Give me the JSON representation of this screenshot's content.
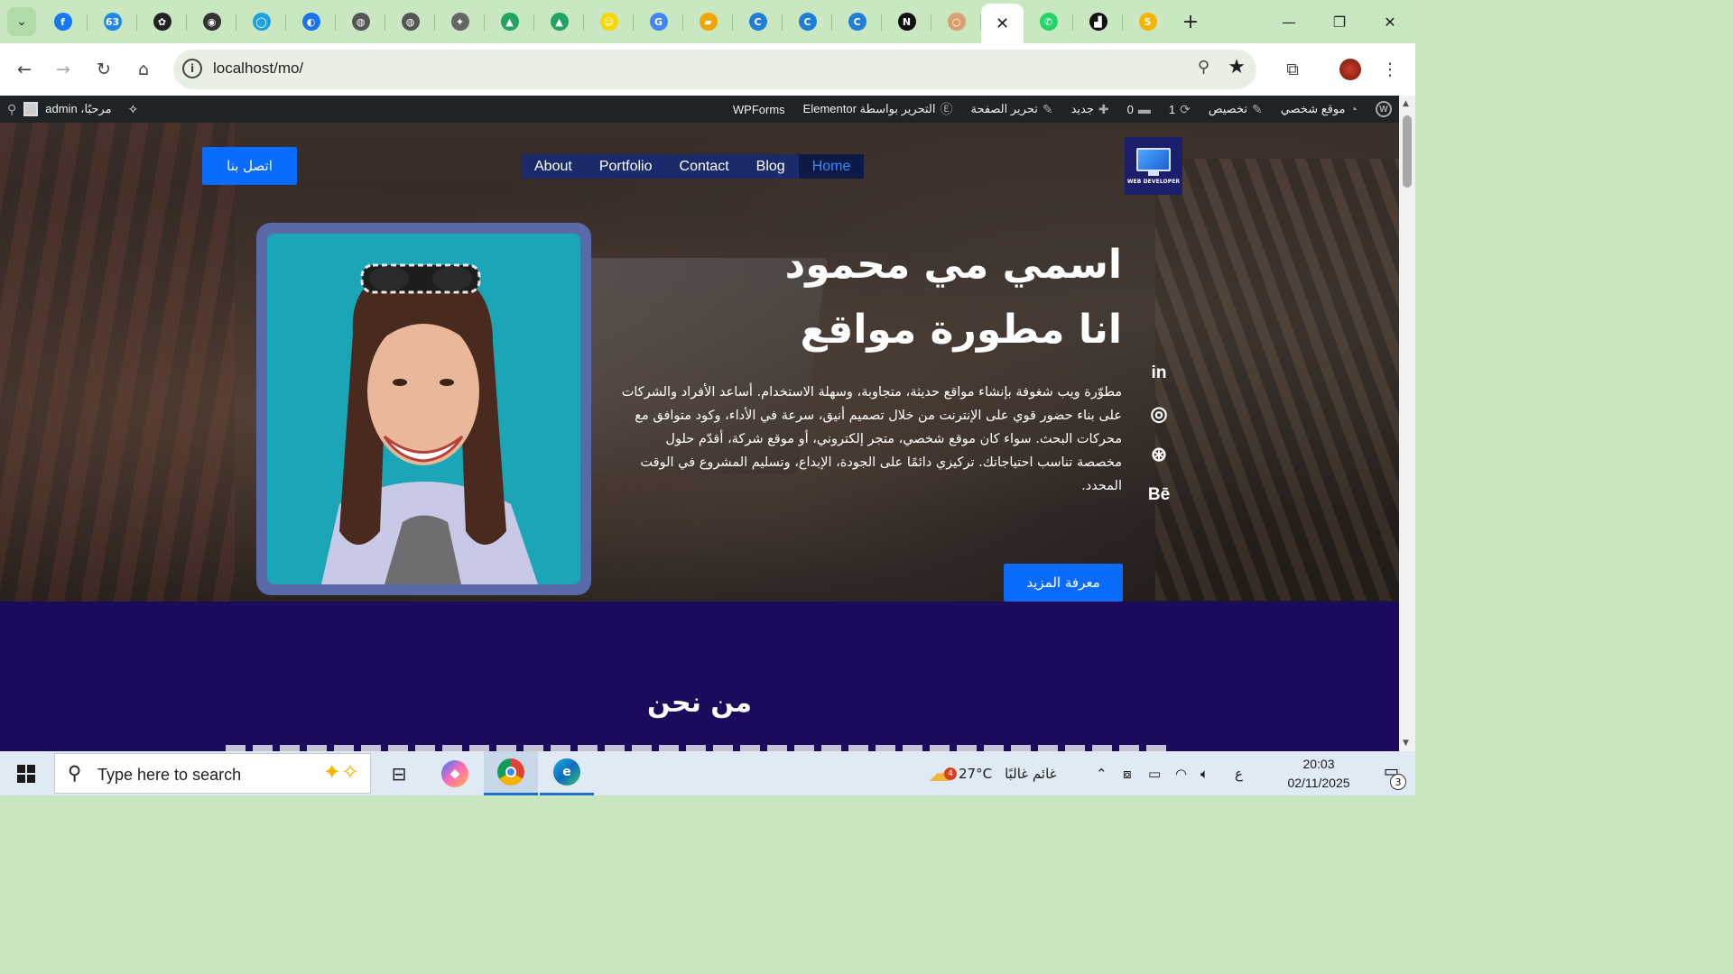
{
  "browser": {
    "tabs": [
      {
        "icon": "facebook-icon",
        "glyph": "f",
        "color": "#1877f2"
      },
      {
        "icon": "notification-count-icon",
        "glyph": "63",
        "color": "#1e88e5"
      },
      {
        "icon": "chatgpt-icon",
        "glyph": "✿",
        "color": "#222222"
      },
      {
        "icon": "panda-icon",
        "glyph": "◉",
        "color": "#333333"
      },
      {
        "icon": "circle-app-icon",
        "glyph": "◯",
        "color": "#1ea1e0"
      },
      {
        "icon": "blue-app-icon",
        "glyph": "◐",
        "color": "#1a73e8"
      },
      {
        "icon": "globe-icon",
        "glyph": "◍",
        "color": "#555555"
      },
      {
        "icon": "globe-icon",
        "glyph": "◍",
        "color": "#555555"
      },
      {
        "icon": "spark-icon",
        "glyph": "✦",
        "color": "#666666"
      },
      {
        "icon": "google-drive-icon",
        "glyph": "▲",
        "color": "#1fa463"
      },
      {
        "icon": "google-drive-icon",
        "glyph": "▲",
        "color": "#1fa463"
      },
      {
        "icon": "snapchat-icon",
        "glyph": "☺",
        "color": "#f7d600"
      },
      {
        "icon": "google-icon",
        "glyph": "G",
        "color": "#4285f4"
      },
      {
        "icon": "course-icon",
        "glyph": "▰",
        "color": "#f0a500"
      },
      {
        "icon": "canva-icon",
        "glyph": "C",
        "color": "#1f7ed6"
      },
      {
        "icon": "canva-icon",
        "glyph": "C",
        "color": "#1f7ed6"
      },
      {
        "icon": "canva-icon",
        "glyph": "C",
        "color": "#1f7ed6"
      },
      {
        "icon": "notion-icon",
        "glyph": "N",
        "color": "#111111"
      },
      {
        "icon": "loading-icon",
        "glyph": "○",
        "color": "#d9a070"
      }
    ],
    "after_tabs": [
      {
        "icon": "whatsapp-icon",
        "glyph": "✆",
        "color": "#25d366"
      },
      {
        "icon": "dark-app-icon",
        "glyph": "▟",
        "color": "#111111"
      },
      {
        "icon": "five-icon",
        "glyph": "5",
        "color": "#f4b400"
      }
    ],
    "url": "localhost/mo/"
  },
  "wpbar": {
    "user_label": "admin ،مرحبًا",
    "site_name": "موقع شخصي",
    "customize": "تخصيص",
    "updates": "1",
    "comments": "0",
    "new": "جديد",
    "edit_page": "تحرير الصفحة",
    "elementor_edit": "التحرير بواسطة Elementor",
    "wpforms": "WPForms"
  },
  "site": {
    "logo_text": "WEB DEVELOPER",
    "nav": [
      "About",
      "Portfolio",
      "Contact",
      "Blog",
      "Home"
    ],
    "contact_button": "اتصل بنا",
    "title_line1": "اسمي مي محمود",
    "title_line2": "انا مطورة مواقع",
    "description": "مطوّرة ويب شغوفة بإنشاء مواقع حديثة، متجاوبة، وسهلة الاستخدام. أساعد الأفراد والشركات على بناء حضور قوي على الإنترنت من خلال تصميم أنيق، سرعة في الأداء، وكود متوافق مع محركات البحث. سواء كان موقع شخصي، متجر إلكتروني، أو موقع شركة، أقدّم حلول مخصصة تناسب احتياجاتك. تركيزي دائمًا على الجودة، الإبداع، وتسليم المشروع في الوقت المحدد.",
    "socials": [
      "in",
      "◎",
      "⊛",
      "Bē"
    ],
    "more_button": "معرفة المزيد",
    "about_title": "من نحن"
  },
  "taskbar": {
    "search_placeholder": "Type here to search",
    "weather_badge": "4",
    "temperature": "27°C",
    "weather_text": "غائم غالبًا",
    "lang": "ع",
    "time": "20:03",
    "date": "02/11/2025",
    "notif_count": "3"
  }
}
